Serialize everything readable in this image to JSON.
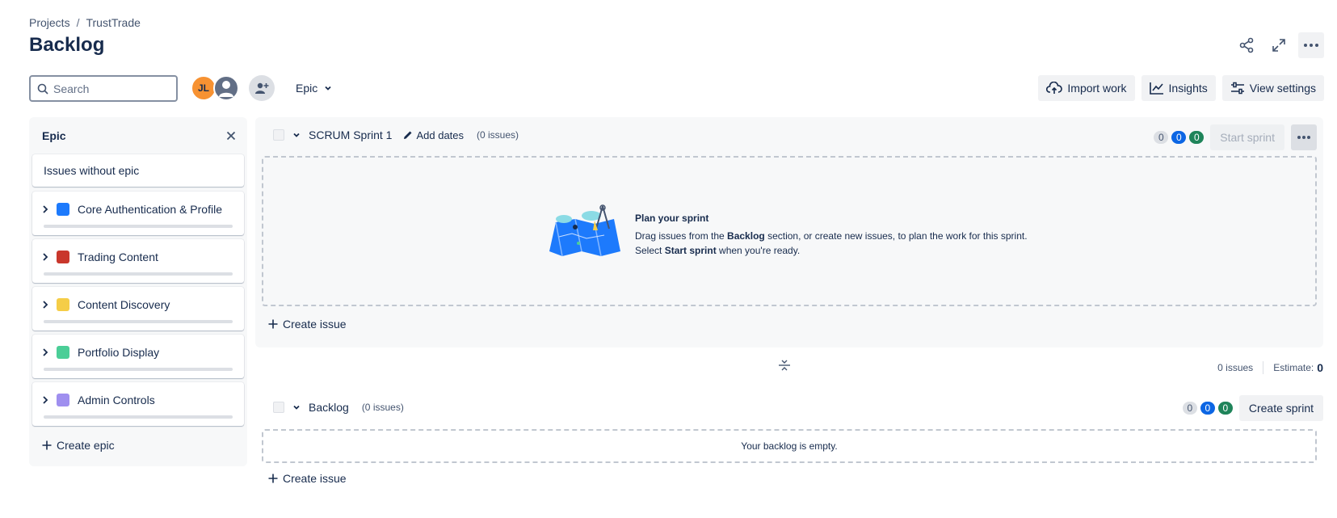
{
  "breadcrumb": {
    "projects": "Projects",
    "separator": "/",
    "project": "TrustTrade"
  },
  "page": {
    "title": "Backlog"
  },
  "header_actions": [
    "share-icon",
    "fullscreen-icon",
    "more-icon"
  ],
  "search": {
    "placeholder": "Search",
    "value": ""
  },
  "avatars": [
    {
      "initials": "JL",
      "color": "#f79232"
    },
    {
      "initials": "",
      "color": "#626f86"
    }
  ],
  "filters": {
    "epic_label": "Epic"
  },
  "toolbar": {
    "import": "Import work",
    "insights": "Insights",
    "view_settings": "View settings"
  },
  "epic_panel": {
    "title": "Epic",
    "no_epic": "Issues without epic",
    "epics": [
      {
        "name": "Core Authentication & Profile",
        "color": "#1d7afc"
      },
      {
        "name": "Trading Content",
        "color": "#c9372c"
      },
      {
        "name": "Content Discovery",
        "color": "#f5cd47"
      },
      {
        "name": "Portfolio Display",
        "color": "#4bce97"
      },
      {
        "name": "Admin Controls",
        "color": "#9f8fef"
      }
    ],
    "create_epic": "Create epic"
  },
  "sprint": {
    "name": "SCRUM Sprint 1",
    "add_dates": "Add dates",
    "issue_count": "(0 issues)",
    "counts": {
      "todo": "0",
      "in_progress": "0",
      "done": "0"
    },
    "start_button": "Start sprint",
    "empty": {
      "title": "Plan your sprint",
      "line1_pre": "Drag issues from the ",
      "line1_bold": "Backlog",
      "line1_post": " section, or create new issues, to plan the work for this sprint.",
      "line2_pre": "Select ",
      "line2_bold": "Start sprint",
      "line2_post": " when you're ready."
    },
    "create_issue": "Create issue"
  },
  "totals": {
    "issues": "0 issues",
    "estimate_label": "Estimate:",
    "estimate_value": "0"
  },
  "backlog": {
    "name": "Backlog",
    "issue_count": "(0 issues)",
    "counts": {
      "todo": "0",
      "in_progress": "0",
      "done": "0"
    },
    "create_sprint": "Create sprint",
    "empty": "Your backlog is empty.",
    "create_issue": "Create issue"
  }
}
